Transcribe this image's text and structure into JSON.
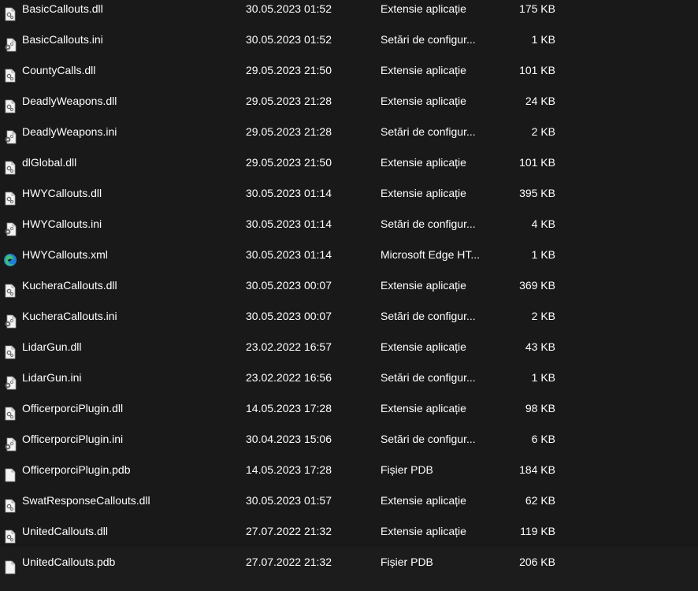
{
  "files": [
    {
      "name": "BasicCallouts.dll",
      "date": "30.05.2023 01:52",
      "type": "Extensie aplicație",
      "size": "175 KB",
      "icon": "dll-file-icon"
    },
    {
      "name": "BasicCallouts.ini",
      "date": "30.05.2023 01:52",
      "type": "Setări de configur...",
      "size": "1 KB",
      "icon": "ini-file-icon"
    },
    {
      "name": "CountyCalls.dll",
      "date": "29.05.2023 21:50",
      "type": "Extensie aplicație",
      "size": "101 KB",
      "icon": "dll-file-icon"
    },
    {
      "name": "DeadlyWeapons.dll",
      "date": "29.05.2023 21:28",
      "type": "Extensie aplicație",
      "size": "24 KB",
      "icon": "dll-file-icon"
    },
    {
      "name": "DeadlyWeapons.ini",
      "date": "29.05.2023 21:28",
      "type": "Setări de configur...",
      "size": "2 KB",
      "icon": "ini-file-icon"
    },
    {
      "name": "dlGlobal.dll",
      "date": "29.05.2023 21:50",
      "type": "Extensie aplicație",
      "size": "101 KB",
      "icon": "dll-file-icon"
    },
    {
      "name": "HWYCallouts.dll",
      "date": "30.05.2023 01:14",
      "type": "Extensie aplicație",
      "size": "395 KB",
      "icon": "dll-file-icon"
    },
    {
      "name": "HWYCallouts.ini",
      "date": "30.05.2023 01:14",
      "type": "Setări de configur...",
      "size": "4 KB",
      "icon": "ini-file-icon"
    },
    {
      "name": "HWYCallouts.xml",
      "date": "30.05.2023 01:14",
      "type": "Microsoft Edge HT...",
      "size": "1 KB",
      "icon": "edge-icon"
    },
    {
      "name": "KucheraCallouts.dll",
      "date": "30.05.2023 00:07",
      "type": "Extensie aplicație",
      "size": "369 KB",
      "icon": "dll-file-icon"
    },
    {
      "name": "KucheraCallouts.ini",
      "date": "30.05.2023 00:07",
      "type": "Setări de configur...",
      "size": "2 KB",
      "icon": "ini-file-icon"
    },
    {
      "name": "LidarGun.dll",
      "date": "23.02.2022 16:57",
      "type": "Extensie aplicație",
      "size": "43 KB",
      "icon": "dll-file-icon"
    },
    {
      "name": "LidarGun.ini",
      "date": "23.02.2022 16:56",
      "type": "Setări de configur...",
      "size": "1 KB",
      "icon": "ini-file-icon"
    },
    {
      "name": "OfficerporciPlugin.dll",
      "date": "14.05.2023 17:28",
      "type": "Extensie aplicație",
      "size": "98 KB",
      "icon": "dll-file-icon"
    },
    {
      "name": "OfficerporciPlugin.ini",
      "date": "30.04.2023 15:06",
      "type": "Setări de configur...",
      "size": "6 KB",
      "icon": "ini-file-icon"
    },
    {
      "name": "OfficerporciPlugin.pdb",
      "date": "14.05.2023 17:28",
      "type": "Fișier PDB",
      "size": "184 KB",
      "icon": "blank-file-icon"
    },
    {
      "name": "SwatResponseCallouts.dll",
      "date": "30.05.2023 01:57",
      "type": "Extensie aplicație",
      "size": "62 KB",
      "icon": "dll-file-icon"
    },
    {
      "name": "UnitedCallouts.dll",
      "date": "27.07.2022 21:32",
      "type": "Extensie aplicație",
      "size": "119 KB",
      "icon": "dll-file-icon"
    },
    {
      "name": "UnitedCallouts.pdb",
      "date": "27.07.2022 21:32",
      "type": "Fișier PDB",
      "size": "206 KB",
      "icon": "blank-file-icon"
    }
  ],
  "colors": {
    "background": "#191919",
    "text": "#ffffff",
    "icon_page": "#f3f3f3",
    "icon_gear": "#7a7a7a",
    "edge_blue": "#1f7fd6",
    "edge_green": "#3fbf6f"
  }
}
